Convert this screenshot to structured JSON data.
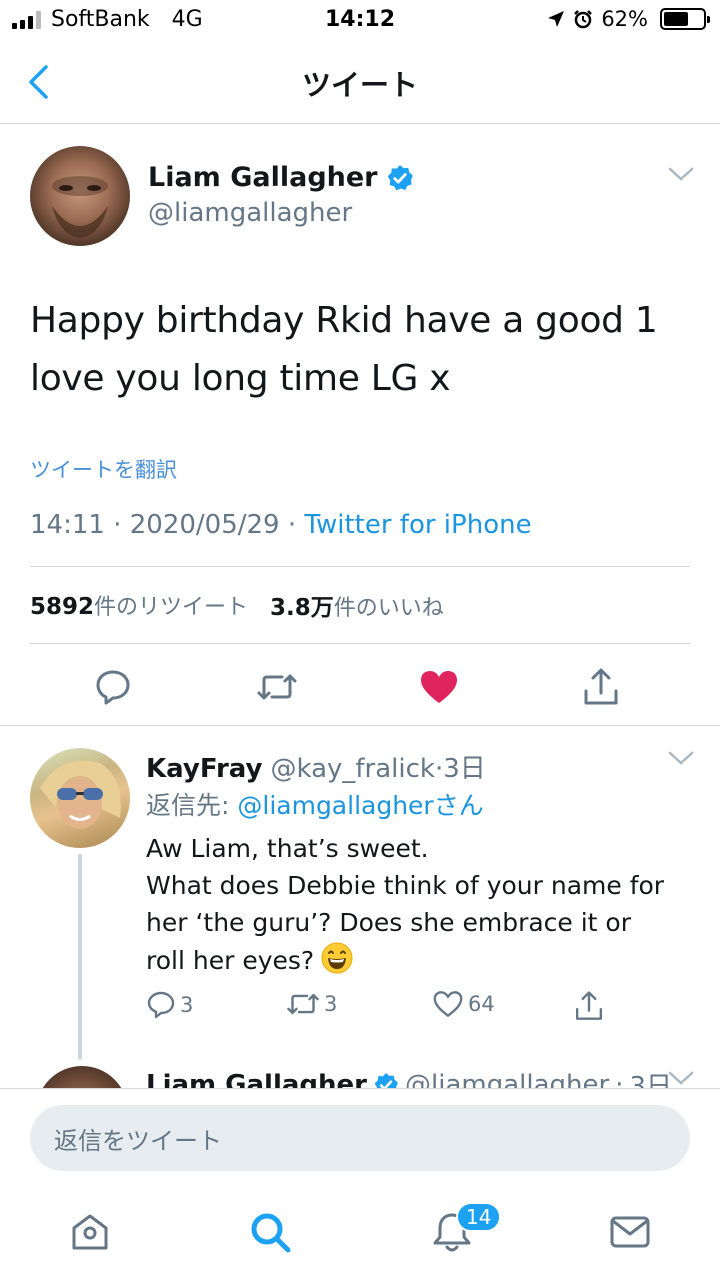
{
  "status_bar": {
    "carrier": "SoftBank",
    "network": "4G",
    "time": "14:12",
    "battery": "62%",
    "battery_level": 0.62
  },
  "nav": {
    "back_icon": "chevron-left-icon",
    "title": "ツイート"
  },
  "tweet": {
    "author_name": "Liam Gallagher",
    "author_handle": "@liamgallagher",
    "verified": true,
    "text_line1": "Happy birthday Rkid have a good 1",
    "text_line2": "love you long time LG x",
    "translate": "ツイートを翻訳",
    "time": "14:11",
    "date": "2020/05/29",
    "source": "Twitter for iPhone",
    "retweets_count": "5892",
    "retweets_label": "件のリツイート",
    "likes_count": "3.8万",
    "likes_label": "件のいいね",
    "liked": true,
    "accent_color": "#1da1f2",
    "like_color": "#e0245e"
  },
  "reply": {
    "author_name": "KayFray",
    "author_handle": "@kay_fralick",
    "age": "3日",
    "replying_prefix": "返信先: ",
    "replying_mention": "@liamgallagher",
    "replying_suffix": "さん",
    "line1": "Aw Liam, that’s sweet.",
    "line2": "What does Debbie think of your name for",
    "line3": "her ‘the guru’?   Does she embrace it or",
    "line4": "roll her eyes?",
    "replies": "3",
    "retweets": "3",
    "likes": "64"
  },
  "next_tweet": {
    "author_name": "Liam Gallagher",
    "author_handle": "@liamgallagher",
    "age": "3日"
  },
  "compose": {
    "placeholder": "返信をツイート"
  },
  "tab_bar": {
    "notifications_badge": "14"
  }
}
